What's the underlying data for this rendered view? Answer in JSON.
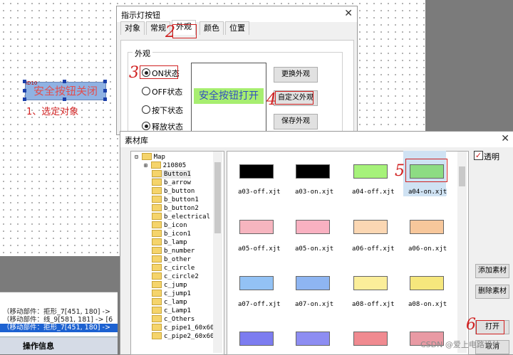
{
  "canvas": {
    "object_label": "安全按钮关闭",
    "object_tag": "ID10",
    "annotation": "1、选定对象"
  },
  "steps": {
    "s2": "2",
    "s3": "3",
    "s4": "4",
    "s5": "5",
    "s6": "6"
  },
  "log": {
    "lines": [
      "（移动部件：拒形_7[451, 180] ->",
      "（移动部件：线_9[581, 181] -> [6",
      "（移动部件：拒形_7[451, 180] ->"
    ],
    "tab": "操作信息"
  },
  "indicator_dialog": {
    "title": "指示灯按钮",
    "tabs": [
      "对象",
      "常规",
      "外观",
      "颜色",
      "位置"
    ],
    "active_tab": "外观",
    "group_label": "外观",
    "states": [
      {
        "label": "ON状态",
        "checked": true
      },
      {
        "label": "OFF状态",
        "checked": false
      },
      {
        "label": "按下状态",
        "checked": false
      },
      {
        "label": "释放状态",
        "checked": true
      }
    ],
    "preview_text": "安全按钮打开",
    "buttons": {
      "change": "更换外观",
      "custom": "自定义外观",
      "save": "保存外观"
    }
  },
  "library_dialog": {
    "title": "素材库",
    "tree": [
      "Map",
      "210805",
      "Button1",
      "b_arrow",
      "b_button",
      "b_button1",
      "b_button2",
      "b_electrical",
      "b_icon",
      "b_icon1",
      "b_lamp",
      "b_number",
      "b_other",
      "c_circle",
      "c_circle2",
      "c_jump",
      "c_jump1",
      "c_lamp",
      "c_Lamp1",
      "c_Others",
      "c_pipe1_60x60",
      "c_pipe2_60x60"
    ],
    "files": [
      {
        "name": "a03-off.xjt",
        "color": "#000000"
      },
      {
        "name": "a03-on.xjt",
        "color": "#000000"
      },
      {
        "name": "a04-off.xjt",
        "color": "#a6f27a"
      },
      {
        "name": "a04-on.xjt",
        "color": "#8ddc83"
      },
      {
        "name": "a05-off.xjt",
        "color": "#f6b5bf"
      },
      {
        "name": "a05-on.xjt",
        "color": "#f9b1c1"
      },
      {
        "name": "a06-off.xjt",
        "color": "#fbd7b3"
      },
      {
        "name": "a06-on.xjt",
        "color": "#f7c79b"
      },
      {
        "name": "a07-off.xjt",
        "color": "#93c2f5"
      },
      {
        "name": "a07-on.xjt",
        "color": "#8eb5f2"
      },
      {
        "name": "a08-off.xjt",
        "color": "#fbee9a"
      },
      {
        "name": "a08-on.xjt",
        "color": "#f6e77d"
      },
      {
        "name": "",
        "color": "#7c7cf0"
      },
      {
        "name": "",
        "color": "#8d8df2"
      },
      {
        "name": "",
        "color": "#f08a90"
      },
      {
        "name": "",
        "color": "#e99aa4"
      }
    ],
    "transparent_label": "透明",
    "buttons": {
      "add": "添加素材",
      "delete": "删除素材",
      "open": "打开",
      "cancel": "取消"
    }
  },
  "watermark": "CSDN @爱上电路设计"
}
